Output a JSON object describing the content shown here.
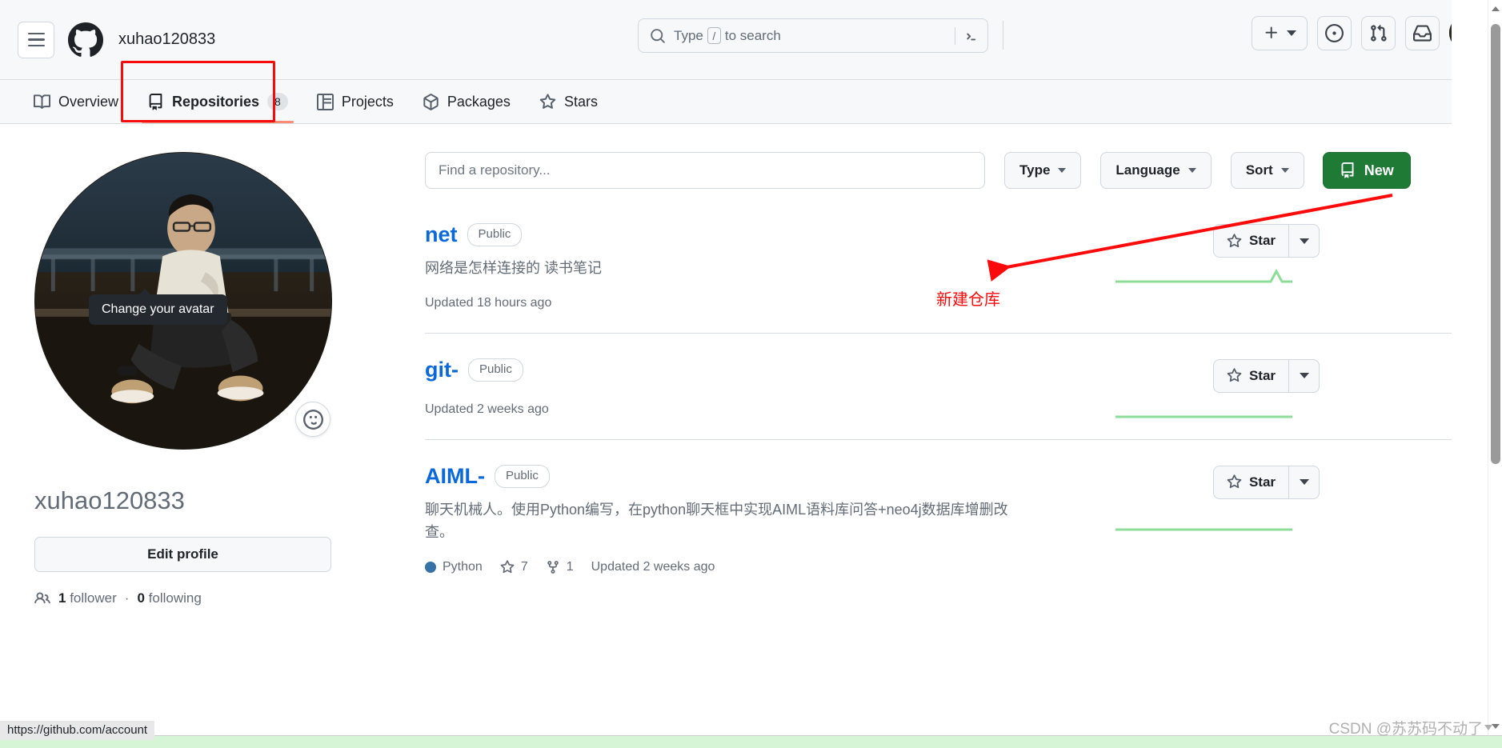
{
  "header": {
    "menu_icon": "hamburger-icon",
    "logo_icon": "github-logo-icon",
    "owner": "xuhao120833",
    "search": {
      "icon": "search-icon",
      "placeholder_before": "Type",
      "kbd": "/",
      "placeholder_after": "to search",
      "terminal_icon": "command-palette-icon"
    },
    "buttons": [
      {
        "name": "create-new-button",
        "icon": "plus-icon",
        "has_caret": true
      },
      {
        "name": "issues-button",
        "icon": "issue-opened-icon"
      },
      {
        "name": "pull-requests-button",
        "icon": "git-pull-request-icon"
      },
      {
        "name": "notifications-button",
        "icon": "inbox-icon"
      },
      {
        "name": "user-avatar-button",
        "icon": "avatar-icon"
      }
    ]
  },
  "tabs": [
    {
      "label": "Overview",
      "icon": "book-icon",
      "count": null,
      "active": false
    },
    {
      "label": "Repositories",
      "icon": "repo-icon",
      "count": "8",
      "active": true
    },
    {
      "label": "Projects",
      "icon": "project-icon",
      "count": null,
      "active": false
    },
    {
      "label": "Packages",
      "icon": "package-icon",
      "count": null,
      "active": false
    },
    {
      "label": "Stars",
      "icon": "star-icon",
      "count": null,
      "active": false
    }
  ],
  "sidebar": {
    "avatar_alt": "profile-avatar",
    "status_icon": "smiley-icon",
    "tooltip": "Change your avatar",
    "username": "xuhao120833",
    "edit_profile_label": "Edit profile",
    "followers_icon": "people-icon",
    "followers_count": "1",
    "followers_label": "follower",
    "separator": "·",
    "following_count": "0",
    "following_label": "following"
  },
  "main": {
    "find_placeholder": "Find a repository...",
    "filters": [
      {
        "name": "type-filter",
        "label": "Type"
      },
      {
        "name": "language-filter",
        "label": "Language"
      },
      {
        "name": "sort-filter",
        "label": "Sort"
      }
    ],
    "new_button": {
      "label": "New",
      "icon": "repo-icon",
      "color": "#1f7a36"
    },
    "star_label": "Star",
    "repos": [
      {
        "name": "net",
        "visibility": "Public",
        "description": "网络是怎样连接的 读书笔记",
        "language": null,
        "language_color": null,
        "stars": null,
        "forks": null,
        "updated": "Updated 18 hours ago"
      },
      {
        "name": "git-",
        "visibility": "Public",
        "description": "",
        "language": null,
        "language_color": null,
        "stars": null,
        "forks": null,
        "updated": "Updated 2 weeks ago"
      },
      {
        "name": "AIML-",
        "visibility": "Public",
        "description": "聊天机械人。使用Python编写，在python聊天框中实现AIML语料库问答+neo4j数据库增删改查。",
        "language": "Python",
        "language_color": "#3572A5",
        "stars": "7",
        "forks": "1",
        "updated": "Updated 2 weeks ago"
      }
    ]
  },
  "annotations": {
    "callout_text": "新建仓库",
    "callout_color": "#fa0a0a",
    "highlight_target": "Repositories"
  },
  "statusbar": {
    "url": "https://github.com/account"
  },
  "watermark": {
    "text": "CSDN @苏苏码不动了"
  }
}
